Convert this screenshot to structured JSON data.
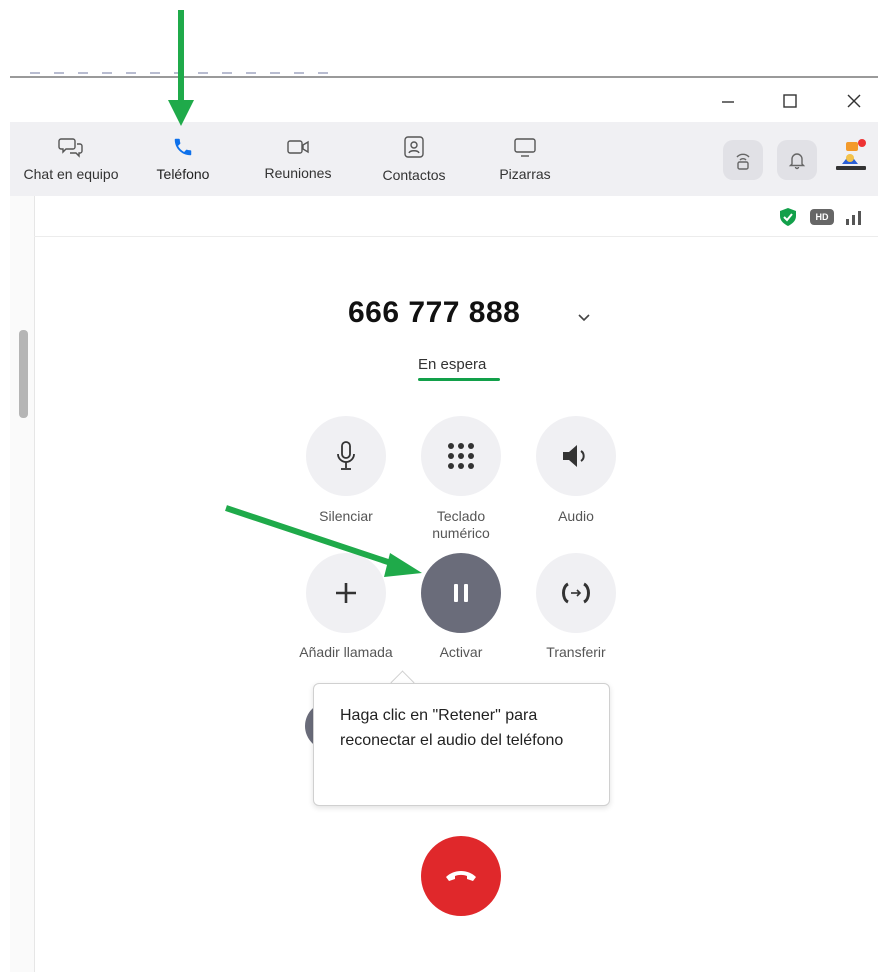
{
  "window_controls": {
    "minimize_glyph": "—",
    "maximize_glyph": "☐",
    "close_glyph": "✕"
  },
  "nav": {
    "items": [
      {
        "label": "Chat en equipo",
        "icon": "chat-icon"
      },
      {
        "label": "Teléfono",
        "icon": "phone-icon",
        "active": true
      },
      {
        "label": "Reuniones",
        "icon": "video-icon"
      },
      {
        "label": "Contactos",
        "icon": "contacts-icon"
      },
      {
        "label": "Pizarras",
        "icon": "whiteboard-icon"
      }
    ],
    "right_icons": [
      "antenna-icon",
      "bell-icon",
      "avatar"
    ]
  },
  "status_icons": {
    "hd_label": "HD"
  },
  "call": {
    "number": "666 777 888",
    "status": "En espera",
    "controls": [
      {
        "label": "Silenciar",
        "icon": "microphone-icon"
      },
      {
        "label": "Teclado numérico",
        "icon": "keypad-icon"
      },
      {
        "label": "Audio",
        "icon": "speaker-icon"
      },
      {
        "label": "Añadir llamada",
        "icon": "plus-icon"
      },
      {
        "label": "Activar",
        "icon": "pause-icon"
      },
      {
        "label": "Transferir",
        "icon": "transfer-icon"
      }
    ]
  },
  "tooltip": {
    "text": "Haga clic en \"Retener\" para reconectar el audio del teléfono"
  },
  "colors": {
    "accent_green": "#12a04a",
    "phone_blue": "#0e71eb",
    "hangup_red": "#e0282b",
    "hold_button": "#6a6c7a",
    "annotation_arrow": "#1faa4a"
  }
}
